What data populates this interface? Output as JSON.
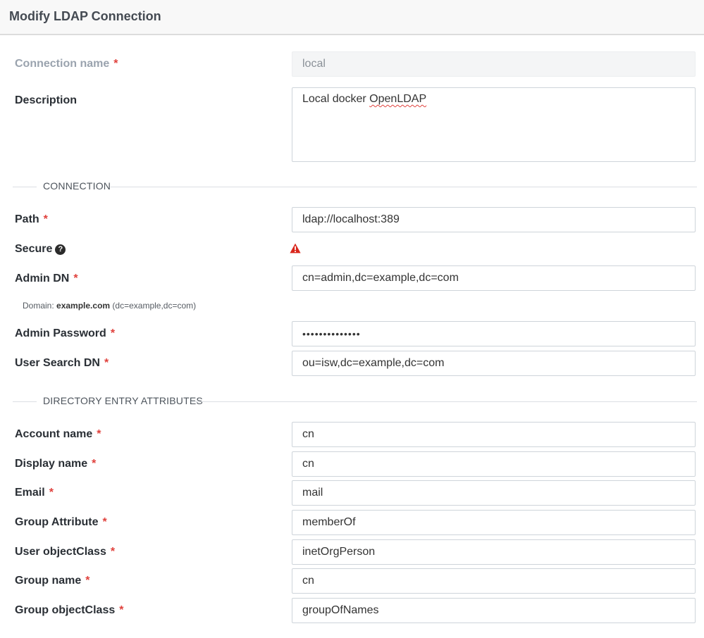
{
  "header": {
    "title": "Modify LDAP Connection"
  },
  "required_marker": "*",
  "fields": {
    "connection_name": {
      "label": "Connection name",
      "value": "local"
    },
    "description": {
      "label": "Description",
      "value_prefix": "Local docker ",
      "value_misspelled": "OpenLDAP"
    },
    "path": {
      "label": "Path",
      "value": "ldap://localhost:389"
    },
    "secure": {
      "label": "Secure",
      "help_icon": "question-circle-icon",
      "status_icon": "warning-triangle-icon"
    },
    "admin_dn": {
      "label": "Admin DN",
      "value": "cn=admin,dc=example,dc=com"
    },
    "admin_password": {
      "label": "Admin Password",
      "value": "••••••••••••••"
    },
    "user_search_dn": {
      "label": "User Search DN",
      "value": "ou=isw,dc=example,dc=com"
    },
    "account_name": {
      "label": "Account name",
      "value": "cn"
    },
    "display_name": {
      "label": "Display name",
      "value": "cn"
    },
    "email": {
      "label": "Email",
      "value": "mail"
    },
    "group_attribute": {
      "label": "Group Attribute",
      "value": "memberOf"
    },
    "user_objectclass": {
      "label": "User objectClass",
      "value": "inetOrgPerson"
    },
    "group_name": {
      "label": "Group name",
      "value": "cn"
    },
    "group_objectclass": {
      "label": "Group objectClass",
      "value": "groupOfNames"
    }
  },
  "domain_hint": {
    "prefix": "Domain:",
    "domain": "example.com",
    "suffix": "(dc=example,dc=com)"
  },
  "sections": {
    "connection": "CONNECTION",
    "attributes": "DIRECTORY ENTRY ATTRIBUTES"
  },
  "colors": {
    "required": "#e0413c",
    "warning": "#d9261c",
    "header_bg": "#f8f8f8"
  }
}
